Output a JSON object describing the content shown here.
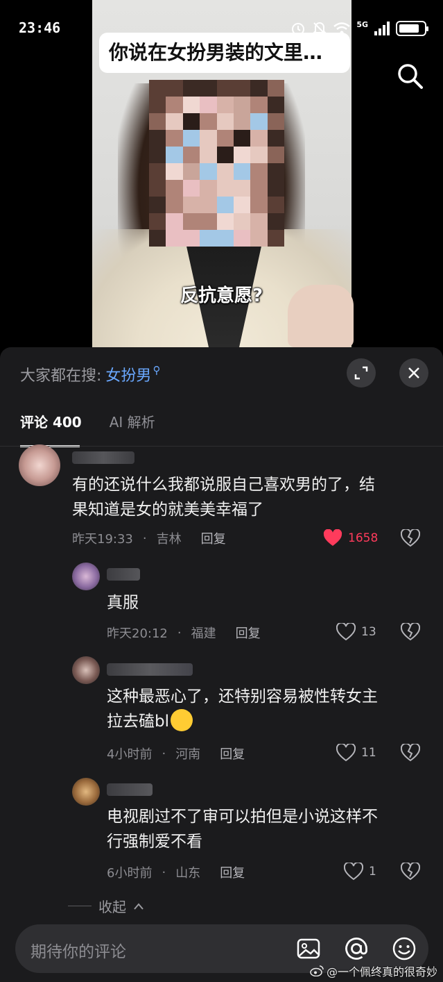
{
  "status_bar": {
    "time": "23:46",
    "network": "5G"
  },
  "video": {
    "title": "你说在女扮男装的文里…",
    "subtitle": "反抗意愿?"
  },
  "trending": {
    "label": "大家都在搜:",
    "term": "女扮男"
  },
  "tabs": [
    {
      "label": "评论 400"
    },
    {
      "label": "AI 解析"
    }
  ],
  "comments": [
    {
      "text_line1": "有的还说什么我都说服自己喜欢男的了，结",
      "text_line2": "果知道是女的就美美幸福了",
      "time": "昨天19:33",
      "location": "吉林",
      "reply": "回复",
      "likes": "1658",
      "liked": true
    }
  ],
  "replies": [
    {
      "text_line1": "真服",
      "text_line2": "",
      "time": "昨天20:12",
      "location": "福建",
      "reply": "回复",
      "likes": "13"
    },
    {
      "text_line1": "这种最恶心了，还特别容易被性转女主",
      "text_line2": "拉去磕bl",
      "time": "4小时前",
      "location": "河南",
      "reply": "回复",
      "likes": "11"
    },
    {
      "text_line1": "电视剧过不了审可以拍但是小说这样不",
      "text_line2": "行强制爱不看",
      "time": "6小时前",
      "location": "山东",
      "reply": "回复",
      "likes": "1"
    }
  ],
  "collapse_label": "收起",
  "input": {
    "placeholder": "期待你的评论"
  },
  "watermark": "@一个佩终真的很奇妙",
  "colors": {
    "accent_blue": "#6aa8ff",
    "like_red": "#ff3b5c",
    "panel_bg": "#1b1b1d"
  }
}
